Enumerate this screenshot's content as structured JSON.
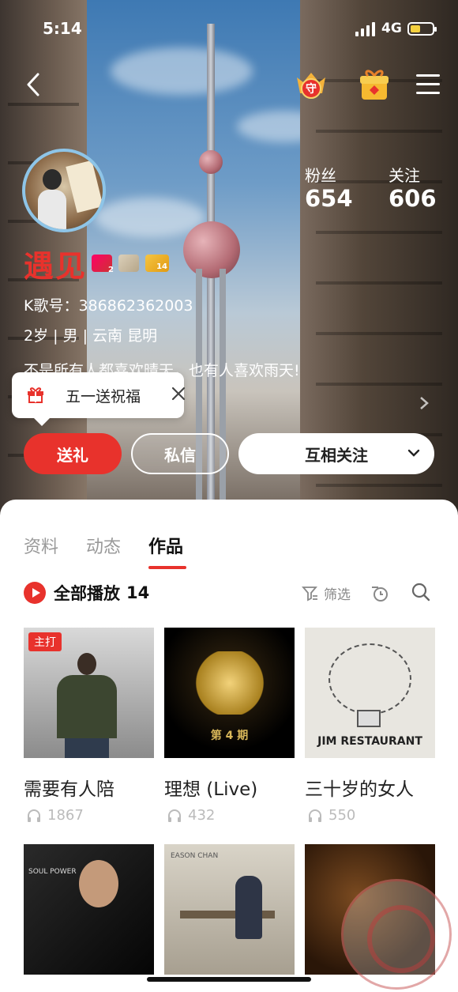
{
  "status_bar": {
    "time": "5:14",
    "network": "4G"
  },
  "profile": {
    "followers_label": "粉丝",
    "followers_value": "654",
    "following_label": "关注",
    "following_value": "606",
    "username": "遇见",
    "badge1_level": "2",
    "badge3_level": "14",
    "ksong_id": "K歌号：386862362003",
    "details": "2岁 | 男 | 云南 昆明",
    "bio": "不是所有人都喜欢晴天，也有人喜欢雨天!"
  },
  "promo": {
    "text": "五一送祝福"
  },
  "actions": {
    "gift": "送礼",
    "message": "私信",
    "follow": "互相关注"
  },
  "tabs": [
    {
      "label": "资料"
    },
    {
      "label": "动态"
    },
    {
      "label": "作品"
    }
  ],
  "toolbar": {
    "play_all": "全部播放",
    "count": "14",
    "filter": "筛选"
  },
  "works": [
    {
      "title": "需要有人陪",
      "plays": "1867",
      "tag": "主打"
    },
    {
      "title": "理想 (Live)",
      "plays": "432",
      "cover_text": "第 4 期"
    },
    {
      "title": "三十岁的女人",
      "plays": "550",
      "cover_text": "JIM RESTAURANT"
    },
    {
      "title": "",
      "plays": "",
      "cover_text": "SOUL POWER"
    },
    {
      "title": "",
      "plays": "",
      "cover_text": "EASON CHAN"
    },
    {
      "title": "",
      "plays": ""
    }
  ],
  "colors": {
    "accent": "#e8322c",
    "text": "#222222",
    "muted": "#bbbbbb"
  }
}
